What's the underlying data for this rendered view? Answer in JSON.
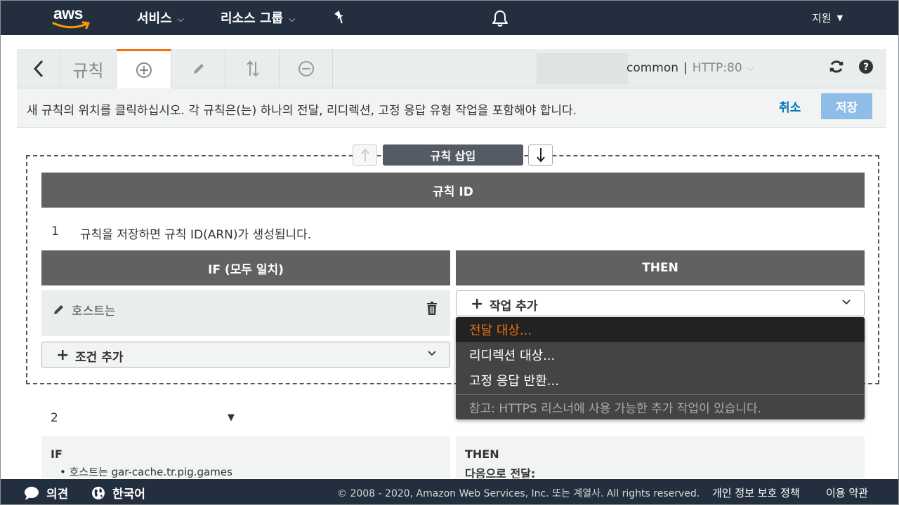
{
  "nav": {
    "logo_text": "aws",
    "services": "서비스",
    "resource_groups": "리소스 그룹",
    "support": "지원",
    "icons": [
      "pin-icon",
      "bell-icon",
      "chevron-down-icon"
    ]
  },
  "toolbar": {
    "title": "규칙",
    "listener_name": "common",
    "separator": "|",
    "listener_port": "HTTP:80",
    "icons": [
      "back-icon",
      "add-circle-icon",
      "pencil-icon",
      "sort-icon",
      "minus-circle-icon",
      "refresh-icon",
      "help-icon"
    ]
  },
  "instruction": {
    "text": "새 규칙의 위치를 클릭하십시오. 각 규칙은(는) 하나의 전달, 리디렉션, 고정 응답 유형 작업을 포함해야 합니다.",
    "cancel": "취소",
    "save": "저장"
  },
  "insert": {
    "label": "규칙 삽입"
  },
  "new_rule": {
    "id_header": "규칙 ID",
    "number": "1",
    "note": "규칙을 저장하면 규칙 ID(ARN)가 생성됩니다.",
    "if_header": "IF (모두 일치)",
    "then_header": "THEN",
    "condition_label": "호스트는",
    "add_condition": "조건 추가",
    "add_action": "작업 추가"
  },
  "action_menu": {
    "items": [
      "전달 대상...",
      "리디렉션 대상...",
      "고정 응답 반환..."
    ],
    "note": "참고: HTTPS 리스너에 사용 가능한 추가 작업이 있습니다.",
    "active_color": "#ec7211"
  },
  "rule2": {
    "number": "2",
    "if_label": "IF",
    "if_line": "• 호스트는 gar-cache.tr.pig.games",
    "then_label": "THEN",
    "then_line": "다음으로 전달:"
  },
  "footer": {
    "feedback": "의견",
    "language": "한국어",
    "copyright": "© 2008 - 2020, Amazon Web Services, Inc. 또는 계열사. All rights reserved.",
    "privacy": "개인 정보 보호 정책",
    "terms": "이용 약관"
  },
  "colors": {
    "nav_bg": "#232f3e",
    "accent": "#ec7211",
    "link": "#0073bb",
    "save_disabled": "#8fbde8",
    "header_gray": "#616161"
  }
}
